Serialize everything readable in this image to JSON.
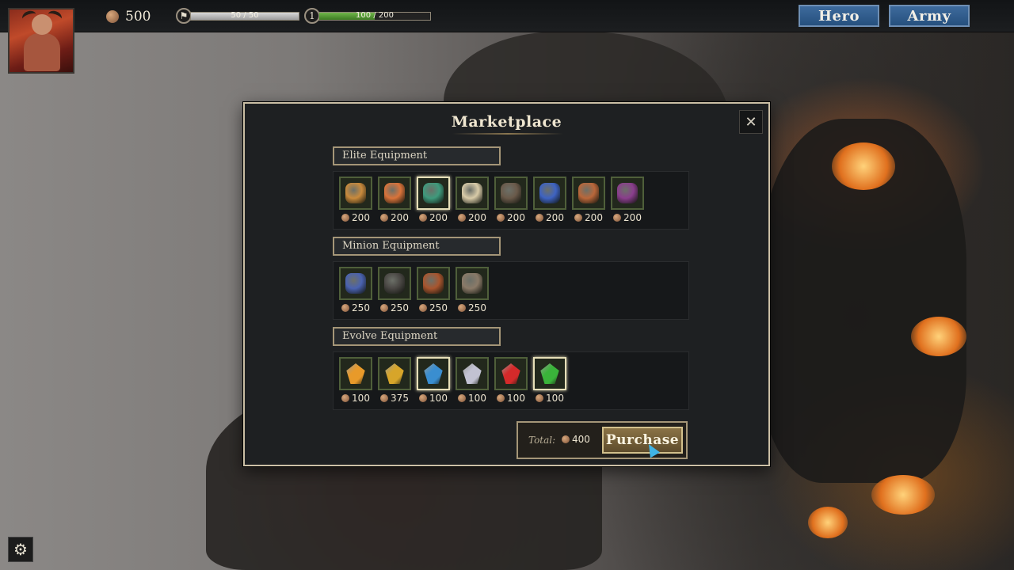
{
  "hud": {
    "gold": "500",
    "flag_bar": {
      "text": "50 / 50",
      "fraction": 1.0,
      "icon": "flag-icon"
    },
    "level_bar": {
      "level": "1",
      "text": "100 / 200",
      "fraction": 0.5
    },
    "buttons": {
      "hero": "Hero",
      "army": "Army"
    },
    "settings_icon": "gear-icon"
  },
  "marketplace": {
    "title": "Marketplace",
    "close_icon": "close-icon",
    "sections": [
      {
        "label": "Elite Equipment",
        "items": [
          {
            "icon": "voodoo-doll-icon",
            "price": "200",
            "color": "#c98a3c"
          },
          {
            "icon": "mushroom-icon",
            "price": "200",
            "color": "#d9733a"
          },
          {
            "icon": "cauldron-icon",
            "price": "200",
            "color": "#3f9a7c",
            "selected": true
          },
          {
            "icon": "scroll-icon",
            "price": "200",
            "color": "#d8cba8"
          },
          {
            "icon": "armor-collar-icon",
            "price": "200",
            "color": "#6a5a4a"
          },
          {
            "icon": "rune-banner-icon",
            "price": "200",
            "color": "#3e63c2"
          },
          {
            "icon": "horn-icon",
            "price": "200",
            "color": "#b9673a"
          },
          {
            "icon": "purple-scroll-icon",
            "price": "200",
            "color": "#8a3e8c"
          }
        ]
      },
      {
        "label": "Minion Equipment",
        "items": [
          {
            "icon": "blue-bracer-icon",
            "price": "250",
            "color": "#4a62b0"
          },
          {
            "icon": "spear-head-icon",
            "price": "250",
            "color": "#4a4744"
          },
          {
            "icon": "round-shield-icon",
            "price": "250",
            "color": "#a8552e"
          },
          {
            "icon": "chest-armor-icon",
            "price": "250",
            "color": "#8a7a68"
          }
        ]
      },
      {
        "label": "Evolve Equipment",
        "items": [
          {
            "icon": "orange-gem-icon",
            "price": "100",
            "color": "#e89a2a"
          },
          {
            "icon": "gold-gem-icon",
            "price": "375",
            "color": "#d7a52a"
          },
          {
            "icon": "blue-gem-icon",
            "price": "100",
            "color": "#3a8ed0",
            "selected": true
          },
          {
            "icon": "silver-gem-icon",
            "price": "100",
            "color": "#c2c2d2"
          },
          {
            "icon": "red-gem-icon",
            "price": "100",
            "color": "#d42a2a"
          },
          {
            "icon": "green-gem-icon",
            "price": "100",
            "color": "#3ab43a",
            "selected": true
          }
        ]
      }
    ],
    "total_label": "Total:",
    "total_value": "400",
    "purchase_label": "Purchase"
  }
}
